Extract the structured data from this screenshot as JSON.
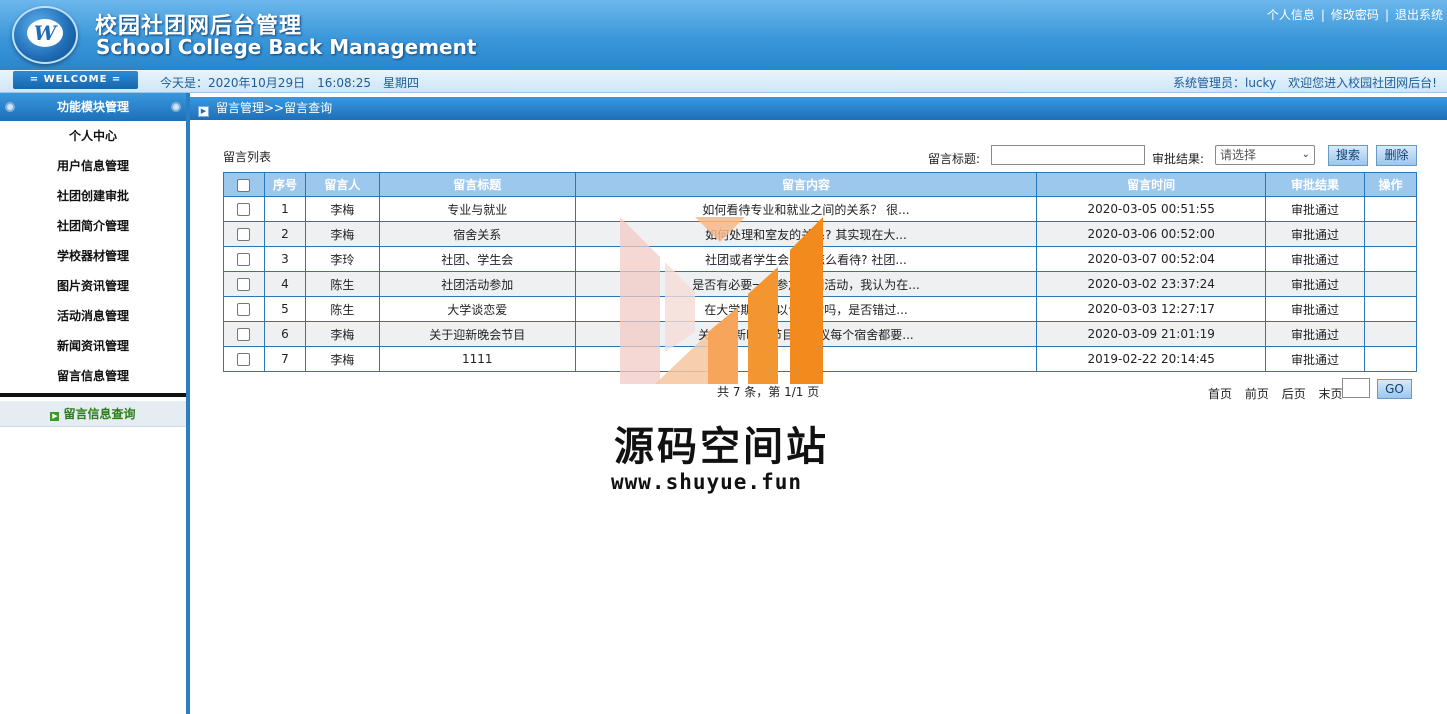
{
  "header": {
    "title_cn": "校园社团网后台管理",
    "title_en": "School College Back Management",
    "logo_letter": "W",
    "links": [
      "个人信息",
      "修改密码",
      "退出系统"
    ],
    "link_separator": "|"
  },
  "info_bar": {
    "welcome": "= WELCOME =",
    "date": "今天是：2020年10月29日　16:08:25　星期四",
    "admin": "系统管理员：lucky　欢迎您进入校园社团网后台!"
  },
  "sidebar": {
    "heading": "功能模块管理",
    "items": [
      "个人中心",
      "用户信息管理",
      "社团创建审批",
      "社团简介管理",
      "学校器材管理",
      "图片资讯管理",
      "活动消息管理",
      "新闻资讯管理",
      "留言信息管理"
    ],
    "sub_item": "留言信息查询"
  },
  "breadcrumb": "留言管理>>留言查询",
  "toolbar": {
    "list_title": "留言列表",
    "title_label": "留言标题:",
    "title_value": "",
    "result_label": "审批结果:",
    "result_selected": "请选择",
    "search_button": "搜索",
    "delete_button": "删除"
  },
  "table": {
    "headers": [
      "序号",
      "留言人",
      "留言标题",
      "留言内容",
      "留言时间",
      "审批结果",
      "操作"
    ],
    "rows": [
      [
        "1",
        "李梅",
        "专业与就业",
        "如何看待专业和就业之间的关系？ 很...",
        "2020-03-05 00:51:55",
        "审批通过",
        ""
      ],
      [
        "2",
        "李梅",
        "宿舍关系",
        "如何处理和室友的关系? 其实现在大...",
        "2020-03-06 00:52:00",
        "审批通过",
        ""
      ],
      [
        "3",
        "李玲",
        "社团、学生会",
        "社团或者学生会应该怎么看待? 社团...",
        "2020-03-07 00:52:04",
        "审批通过",
        ""
      ],
      [
        "4",
        "陈生",
        "社团活动参加",
        "是否有必要一直参加社团活动，我认为在...",
        "2020-03-02 23:37:24",
        "审批通过",
        ""
      ],
      [
        "5",
        "陈生",
        "大学谈恋爱",
        "在大学期间可以谈恋爱吗，是否错过...",
        "2020-03-03 12:27:17",
        "审批通过",
        ""
      ],
      [
        "6",
        "李梅",
        "关于迎新晚会节目",
        "关于迎新晚会节目，建议每个宿舍都要...",
        "2020-03-09 21:01:19",
        "审批通过",
        ""
      ],
      [
        "7",
        "李梅",
        "1111",
        "",
        "2019-02-22 20:14:45",
        "审批通过",
        ""
      ]
    ]
  },
  "pager": {
    "summary": "共 7 条，第 1/1 页",
    "first": "首页",
    "prev": "前页",
    "next": "后页",
    "last": "末页",
    "go": "GO"
  },
  "watermark": {
    "name": "源码空间站",
    "url": "www.shuyue.fun"
  },
  "colors": {
    "header_blue": "#3b97da",
    "table_header": "#9dc8ee",
    "menu_green": "#2e7d1a",
    "watermark_orange": "#f28a1d"
  }
}
